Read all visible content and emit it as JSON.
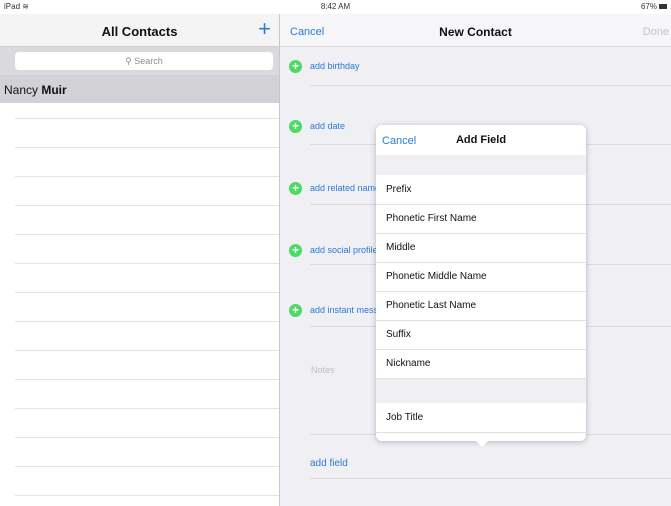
{
  "status_bar": {
    "device": "iPad",
    "time": "8:42 AM",
    "battery": "67%"
  },
  "contacts_panel": {
    "title": "All Contacts",
    "add_icon": "plus-icon",
    "search_placeholder": "Search",
    "selected_contact": {
      "first": "Nancy",
      "last": "Muir"
    }
  },
  "new_contact": {
    "cancel_label": "Cancel",
    "title": "New Contact",
    "done_label": "Done",
    "rows": [
      {
        "label": "add birthday"
      },
      {
        "label": "add date"
      },
      {
        "label": "add related name"
      },
      {
        "label": "add social profile"
      },
      {
        "label": "add instant message"
      }
    ],
    "notes_placeholder": "Notes",
    "add_field_label": "add field"
  },
  "add_field_popover": {
    "cancel_label": "Cancel",
    "title": "Add Field",
    "items": [
      "Prefix",
      "Phonetic First Name",
      "Middle",
      "Phonetic Middle Name",
      "Phonetic Last Name",
      "Suffix",
      "Nickname"
    ],
    "items_second_group": [
      "Job Title"
    ]
  },
  "colors": {
    "accent": "#2a7bd4",
    "add_green": "#4cd964",
    "selection": "#d1d1d6"
  }
}
